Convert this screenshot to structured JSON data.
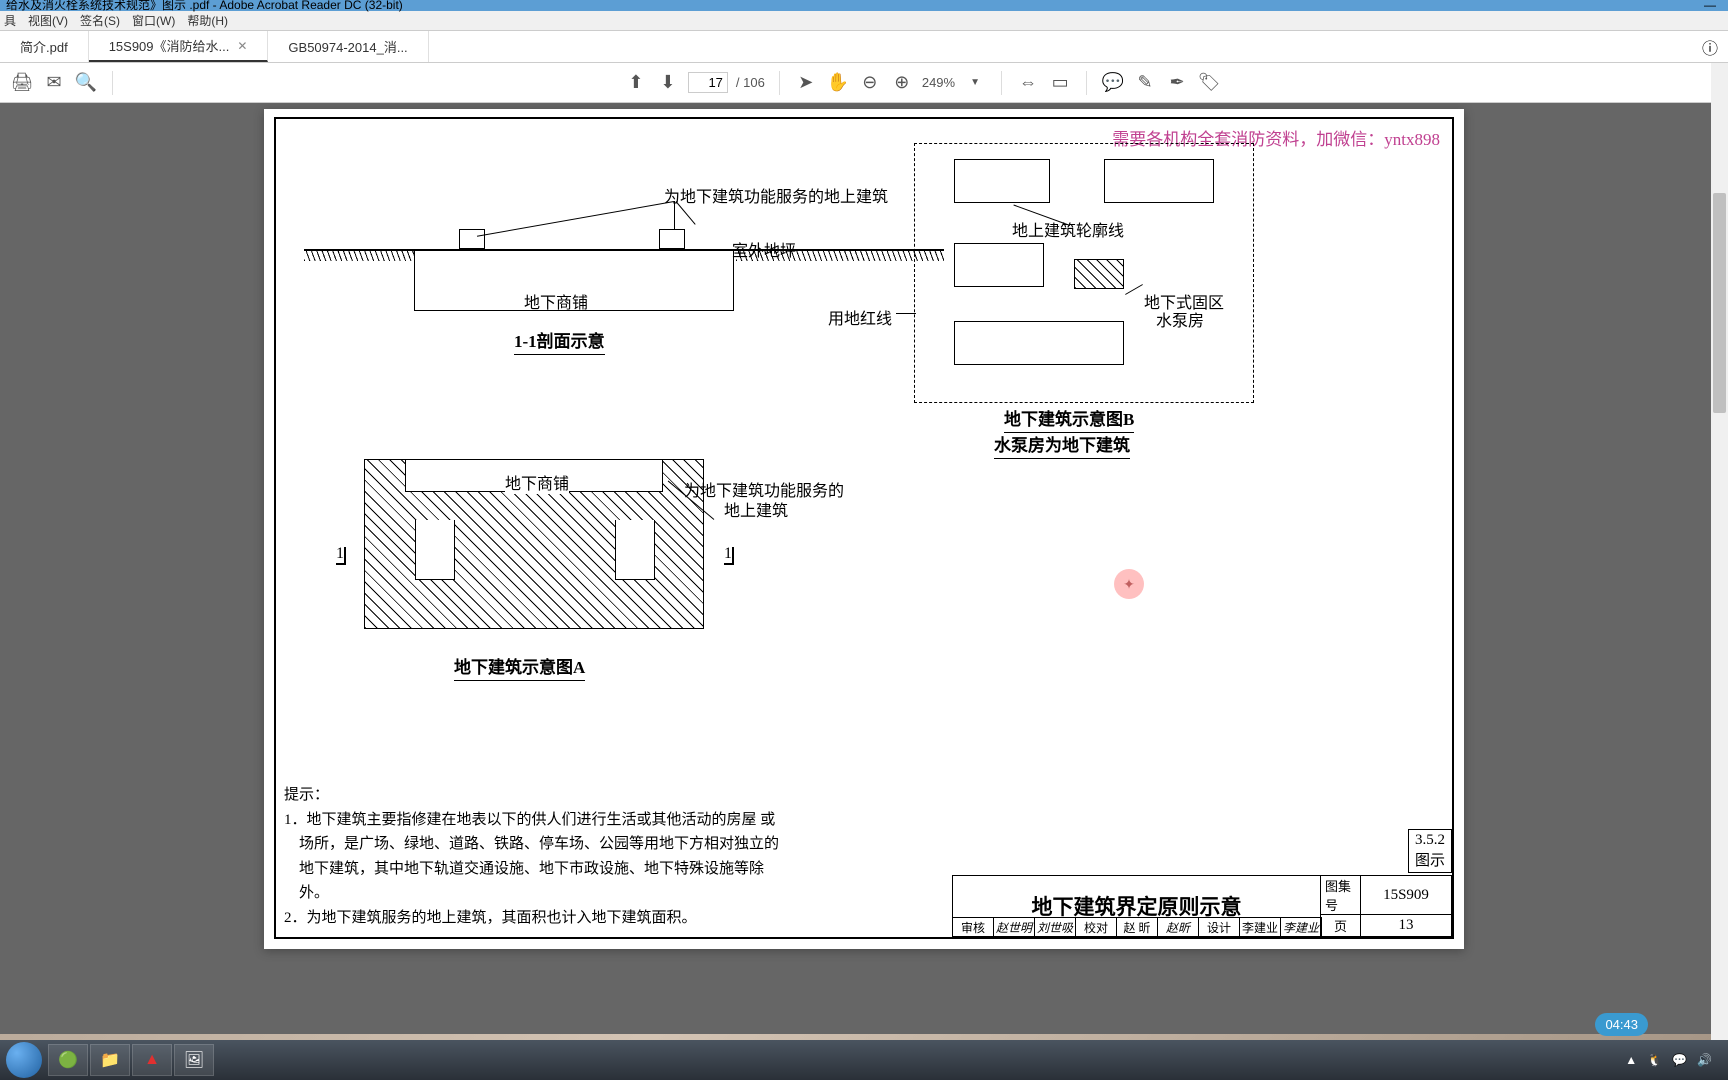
{
  "app": {
    "title": "给水及消火栓系统技术规范》图示 .pdf - Adobe Acrobat Reader DC (32-bit)"
  },
  "menu": {
    "tools": "具",
    "view": "视图(V)",
    "sign": "签名(S)",
    "window": "窗口(W)",
    "help": "帮助(H)"
  },
  "tabs": [
    {
      "label": "简介.pdf",
      "active": false
    },
    {
      "label": "15S909《消防给水...",
      "active": true
    },
    {
      "label": "GB50974-2014_消...",
      "active": false
    }
  ],
  "toolbar": {
    "page_current": "17",
    "page_total": "/ 106",
    "zoom": "249%"
  },
  "doc": {
    "watermark": "需要各机构全套消防资料，加微信：yntx898",
    "sec1": {
      "above_label": "为地下建筑功能服务的地上建筑",
      "ground_label": "室外地坪",
      "shop_label": "地下商铺",
      "title": "1-1剖面示意"
    },
    "secB": {
      "outline_label": "地上建筑轮廓线",
      "redline_label": "用地红线",
      "pump_label1": "地下式固区",
      "pump_label2": "水泵房",
      "title1": "地下建筑示意图B",
      "title2": "水泵房为地下建筑"
    },
    "secA": {
      "shop_label": "地下商铺",
      "above_label1": "为地下建筑功能服务的",
      "above_label2": "地上建筑",
      "marker": "1",
      "title": "地下建筑示意图A"
    },
    "notes": {
      "head": "提示：",
      "n1a": "1．地下建筑主要指修建在地表以下的供人们进行生活或其他活动的房屋 或",
      "n1b": "场所，是广场、绿地、道路、铁路、停车场、公园等用地下方相对独立的",
      "n1c": "地下建筑，其中地下轨道交通设施、地下市政设施、地下特殊设施等除",
      "n1d": "外。",
      "n2": "2．为地下建筑服务的地上建筑，其面积也计入地下建筑面积。"
    },
    "titleblock": {
      "top": "3.5.2图示",
      "main": "地下建筑界定原则示意",
      "set_lbl": "图集号",
      "set_val": "15S909",
      "page_lbl": "页",
      "page_val": "13",
      "sigs": [
        "审核",
        "赵世明",
        "刘世吸",
        "校对",
        "赵 昕",
        "赵昕",
        "设计",
        "李建业",
        "李建业"
      ]
    }
  },
  "timer": "04:43",
  "tray": {
    "time": ""
  }
}
